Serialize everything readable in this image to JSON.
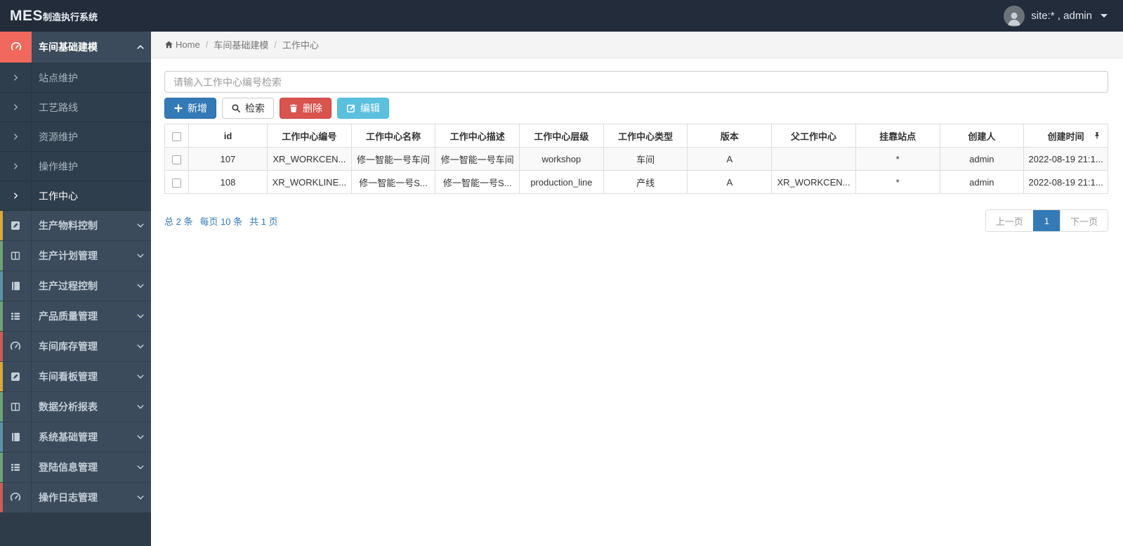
{
  "topbar": {
    "brand_bold": "MES",
    "brand_rest": "制造执行系统",
    "user": "site:* , admin"
  },
  "sidebar": {
    "active_parent": {
      "label": "车间基础建模",
      "icon": "gauge-icon"
    },
    "submenu": [
      {
        "label": "站点维护",
        "active": false
      },
      {
        "label": "工艺路线",
        "active": false
      },
      {
        "label": "资源维护",
        "active": false
      },
      {
        "label": "操作维护",
        "active": false
      },
      {
        "label": "工作中心",
        "active": true
      }
    ],
    "parents": [
      {
        "label": "生产物料控制",
        "icon": "pencil-square-icon",
        "strip": "#dba83a"
      },
      {
        "label": "生产计划管理",
        "icon": "columns-icon",
        "strip": "#70a276"
      },
      {
        "label": "生产过程控制",
        "icon": "book-icon",
        "strip": "#5b93a8"
      },
      {
        "label": "产品质量管理",
        "icon": "list-icon",
        "strip": "#70a276"
      },
      {
        "label": "车间库存管理",
        "icon": "gauge-icon",
        "strip": "#ce5c57"
      },
      {
        "label": "车间看板管理",
        "icon": "pencil-square-icon",
        "strip": "#dba83a"
      },
      {
        "label": "数据分析报表",
        "icon": "columns-icon",
        "strip": "#70a276"
      },
      {
        "label": "系统基础管理",
        "icon": "book-icon",
        "strip": "#5b93a8"
      },
      {
        "label": "登陆信息管理",
        "icon": "list-icon",
        "strip": "#70a276"
      },
      {
        "label": "操作日志管理",
        "icon": "gauge-icon",
        "strip": "#ce5c57"
      }
    ]
  },
  "breadcrumb": {
    "home": "Home",
    "items": [
      "车间基础建模",
      "工作中心"
    ],
    "separator": "/"
  },
  "search": {
    "placeholder": "请输入工作中心编号检索"
  },
  "toolbar": {
    "add_label": "新增",
    "search_label": "检索",
    "delete_label": "删除",
    "edit_label": "编辑"
  },
  "table": {
    "headers": [
      "id",
      "工作中心编号",
      "工作中心名称",
      "工作中心描述",
      "工作中心层级",
      "工作中心类型",
      "版本",
      "父工作中心",
      "挂靠站点",
      "创建人",
      "创建时间"
    ],
    "rows": [
      [
        "107",
        "XR_WORKCEN...",
        "修一智能一号车间",
        "修一智能一号车间",
        "workshop",
        "车间",
        "A",
        "",
        "*",
        "admin",
        "2022-08-19 21:1..."
      ],
      [
        "108",
        "XR_WORKLINE...",
        "修一智能一号S...",
        "修一智能一号S...",
        "production_line",
        "产线",
        "A",
        "XR_WORKCEN...",
        "*",
        "admin",
        "2022-08-19 21:1..."
      ]
    ]
  },
  "pagination": {
    "summary_total": "总 2 条",
    "summary_per_page": "每页 10 条",
    "summary_pages": "共 1 页",
    "prev_label": "上一页",
    "current_page": "1",
    "next_label": "下一页"
  },
  "colors": {
    "topbar_bg": "#232c3b",
    "sidebar_row_bg": "#3b4b5b",
    "sidebar_submenu_bg": "#2f3e4c",
    "active_icon_coral": "#f1695c",
    "primary_blue": "#337ab7",
    "danger_red": "#d9534f",
    "info_cyan": "#5bc0de",
    "strip_yellow": "#dba83a",
    "strip_green": "#70a276",
    "strip_teal": "#5b93a8",
    "strip_red": "#ce5c57"
  }
}
